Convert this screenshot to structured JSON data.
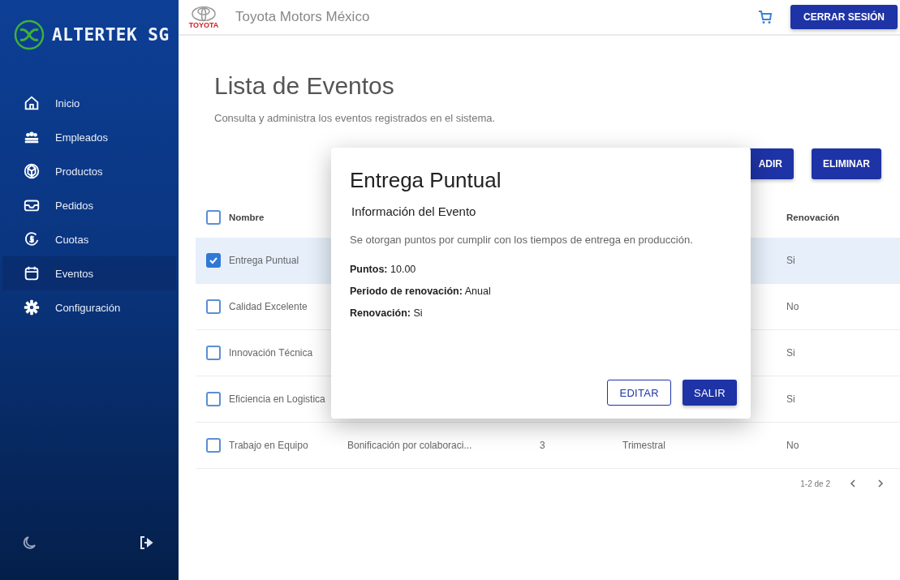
{
  "sidebar": {
    "logo": "ALTERTEK SG",
    "items": [
      {
        "label": "Inicio",
        "kind": "home",
        "selected": false
      },
      {
        "label": "Empleados",
        "kind": "people",
        "selected": false
      },
      {
        "label": "Productos",
        "kind": "cube",
        "selected": false
      },
      {
        "label": "Pedidos",
        "kind": "inbox",
        "selected": false
      },
      {
        "label": "Cuotas",
        "kind": "money",
        "selected": false
      },
      {
        "label": "Eventos",
        "kind": "calendar",
        "selected": true
      },
      {
        "label": "Configuración",
        "kind": "gear",
        "selected": false
      }
    ]
  },
  "topbar": {
    "brand": "TOYOTA",
    "company": "Toyota Motors México",
    "logout": "CERRAR SESIÓN"
  },
  "page": {
    "title": "Lista de Eventos",
    "subtitle": "Consulta y administra los eventos registrados en el sistema.",
    "buttons": [
      "ADIR",
      "ELIMINAR"
    ]
  },
  "table": {
    "columns": [
      "Nombre",
      "Renovación"
    ],
    "header_checked": false,
    "rows": [
      {
        "name": "Entrega Puntual",
        "renewal": "Si",
        "selected": true
      },
      {
        "name": "Calidad Excelente",
        "renewal": "No",
        "selected": false
      },
      {
        "name": "Innovación Técnica",
        "renewal": "Si",
        "selected": false
      },
      {
        "name": "Eficiencia en Logistica",
        "renewal": "Si",
        "selected": false
      },
      {
        "name": "Trabajo en Equipo",
        "description": "Bonificación por colaboraci...",
        "points": "3",
        "period": "Trimestral",
        "renewal": "No",
        "selected": false
      }
    ],
    "pagination": "1-2 de 2"
  },
  "dialog": {
    "title": "Entrega Puntual",
    "subtitle": "Información del Evento",
    "description": "Se otorgan puntos por cumplir con los tiempos de entrega en producción.",
    "fields": [
      "**Puntos:** 10.00",
      "**Periodo de renovación:** Anual",
      "**Renovación:** Si"
    ],
    "buttons": [
      {
        "label": "EDITAR",
        "kind": "outlined"
      },
      {
        "label": "SALIR",
        "kind": "filled"
      }
    ]
  }
}
